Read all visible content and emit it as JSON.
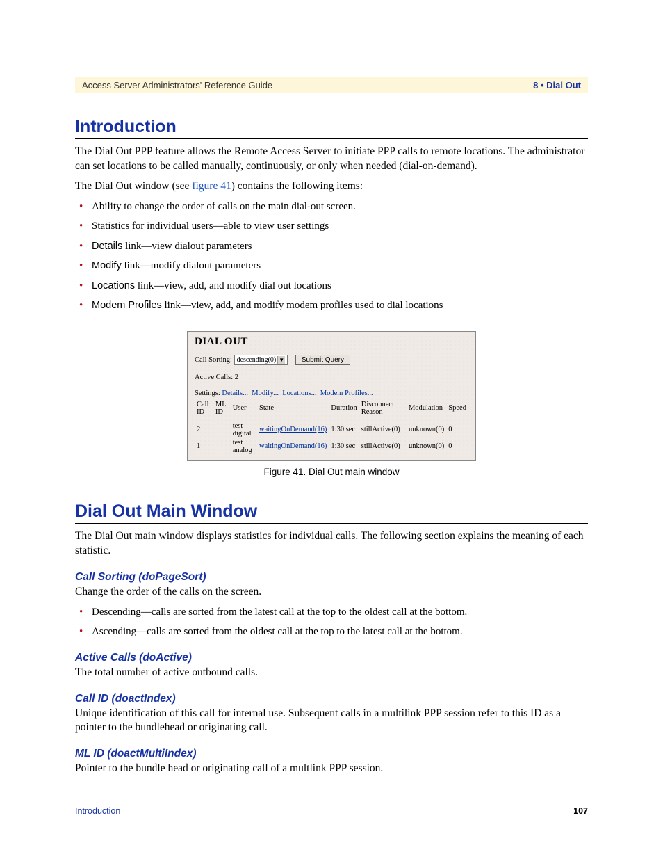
{
  "header": {
    "left": "Access Server Administrators' Reference Guide",
    "right": "8 • Dial Out"
  },
  "h1_intro": "Introduction",
  "p_intro_1": "The Dial Out PPP feature allows the Remote Access Server to initiate PPP calls to remote locations. The administrator can set locations to be called manually, continuously, or only when needed (dial-on-demand).",
  "p_intro_2_pre": "The Dial Out window (see ",
  "p_intro_2_ref": "figure 41",
  "p_intro_2_post": ") contains the following items:",
  "bullets1": {
    "b0": "Ability to change the order of calls on the main dial-out screen.",
    "b1": "Statistics for individual users—able to view user settings",
    "b2_term": "Details",
    "b2_rest": " link—view dialout parameters",
    "b3_term": "Modify",
    "b3_rest": " link—modify dialout parameters",
    "b4_term": "Locations",
    "b4_rest": " link—view, add, and modify dial out locations",
    "b5_term": "Modem Profiles",
    "b5_rest": " link—view, add, and modify modem profiles used to dial locations"
  },
  "figure": {
    "title": "DIAL OUT",
    "sort_label": "Call Sorting:",
    "sort_value": "descending(0)",
    "submit": "Submit Query",
    "active_calls": "Active Calls: 2",
    "settings_label": "Settings:",
    "links": {
      "details": "Details...",
      "modify": "Modify...",
      "locations": "Locations...",
      "modem": "Modem Profiles..."
    },
    "cols": {
      "c0": "Call ID",
      "c1": "ML ID",
      "c2": "User",
      "c3": "State",
      "c4": "Duration",
      "c5": "Disconnect Reason",
      "c6": "Modulation",
      "c7": "Speed"
    },
    "rows": [
      {
        "id": "2",
        "ml": "",
        "user": "test digital",
        "state": "waitingOnDemand(16)",
        "dur": "1:30 sec",
        "disc": "stillActive(0)",
        "mod": "unknown(0)",
        "speed": "0"
      },
      {
        "id": "1",
        "ml": "",
        "user": "test analog",
        "state": "waitingOnDemand(16)",
        "dur": "1:30 sec",
        "disc": "stillActive(0)",
        "mod": "unknown(0)",
        "speed": "0"
      }
    ],
    "caption": "Figure 41. Dial Out main window"
  },
  "h1_main": "Dial Out Main Window",
  "p_main_1": "The Dial Out main window displays statistics for individual calls. The following section explains the meaning of each statistic.",
  "sub1": "Call Sorting (doPageSort)",
  "sub1_p": "Change the order of the calls on the screen.",
  "sub1_bullets": {
    "b0": "Descending—calls are sorted from the latest call at the top to the oldest call at the bottom.",
    "b1": "Ascending—calls are sorted from the oldest call at the top to the latest call at the bottom."
  },
  "sub2": "Active Calls (doActive)",
  "sub2_p": "The total number of active outbound calls.",
  "sub3": "Call ID (doactIndex)",
  "sub3_p": "Unique identification of this call for internal use. Subsequent calls in a multilink PPP session refer to this ID as a pointer to the bundlehead or originating call.",
  "sub4": "ML ID (doactMultiIndex)",
  "sub4_p": "Pointer to the bundle head or originating call of a multlink PPP session.",
  "footer": {
    "left": "Introduction",
    "right": "107"
  }
}
